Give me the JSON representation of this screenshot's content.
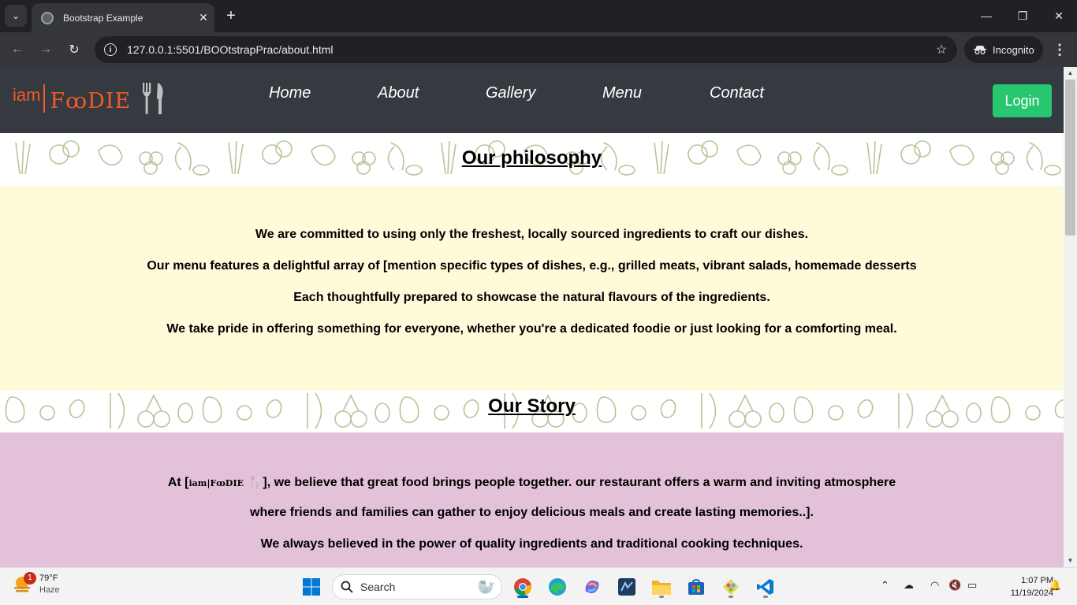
{
  "browser": {
    "tab_title": "Bootstrap Example",
    "url": "127.0.0.1:5501/BOOtstrapPrac/about.html",
    "incognito_label": "Incognito"
  },
  "site": {
    "logo": {
      "iam": "iam",
      "foodie": "FꝏDIE"
    },
    "nav": {
      "home": "Home",
      "about": "About",
      "gallery": "Gallery",
      "menu": "Menu",
      "contact": "Contact"
    },
    "login": "Login"
  },
  "philosophy": {
    "title": "Our philosophy",
    "lines": [
      "We are committed to using only the freshest, locally sourced ingredients to craft our dishes.",
      "Our menu features a delightful array of [mention specific types of dishes, e.g., grilled meats, vibrant salads, homemade desserts",
      "Each thoughtfully prepared to showcase the natural flavours of the ingredients.",
      "We take pride in offering something for everyone, whether you're a dedicated foodie or just looking for a comforting meal."
    ]
  },
  "story": {
    "title": "Our Story",
    "line1_prefix": "At [",
    "line1_logo_iam": "iam",
    "line1_logo_foodie": "|FꝏDIE",
    "line1_suffix": "], we believe that great food brings people together. our restaurant offers a warm and inviting atmosphere",
    "line2": "where friends and families can gather to enjoy delicious meals and create lasting memories..].",
    "line3": "We always believed in the power of quality ingredients and traditional cooking techniques."
  },
  "taskbar": {
    "weather_temp": "79°F",
    "weather_desc": "Haze",
    "weather_badge": "1",
    "search_placeholder": "Search",
    "time": "1:07 PM",
    "date": "11/19/2024"
  }
}
